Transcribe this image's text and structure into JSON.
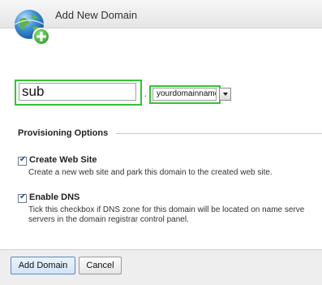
{
  "dialog": {
    "title": "Add New Domain",
    "icon": "globe-add-icon"
  },
  "domain": {
    "subdomain_value": "sub",
    "separator": ".",
    "selected_domain": "yourdomainname",
    "highlight_color": "#33c433"
  },
  "provisioning": {
    "title": "Provisioning Options",
    "options": [
      {
        "label": "Create Web Site",
        "checked": true,
        "description": "Create a new web site and park this domain to the created web site."
      },
      {
        "label": "Enable DNS",
        "checked": true,
        "description": "Tick this checkbox if DNS zone for this domain will be located on name servers of this hosting control panel. Otherwise uncheck it and specify name servers in the domain registrar control panel.",
        "description_line1": "Tick this checkbox if DNS zone for this domain will be located on name serve",
        "description_line2": "servers in the domain registrar control panel."
      }
    ]
  },
  "footer": {
    "add_label": "Add Domain",
    "cancel_label": "Cancel"
  }
}
